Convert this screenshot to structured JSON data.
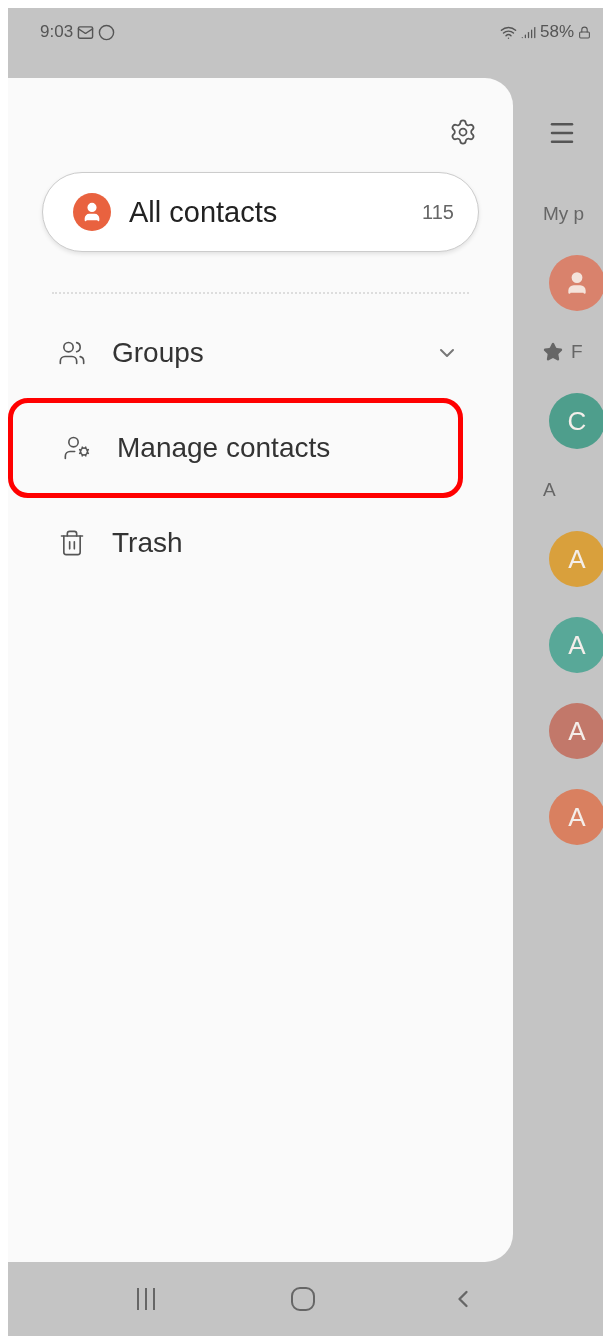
{
  "status_bar": {
    "time": "9:03",
    "battery": "58%"
  },
  "drawer": {
    "all_contacts": {
      "label": "All contacts",
      "count": "115"
    },
    "items": [
      {
        "kind": "groups",
        "label": "Groups",
        "expandable": true,
        "highlighted": false
      },
      {
        "kind": "manage",
        "label": "Manage contacts",
        "expandable": false,
        "highlighted": true
      },
      {
        "kind": "trash",
        "label": "Trash",
        "expandable": false,
        "highlighted": false
      }
    ]
  },
  "background_list": {
    "entries": [
      {
        "kind": "header",
        "label": "My p"
      },
      {
        "kind": "profile",
        "color": "#d9826c"
      },
      {
        "kind": "favorites",
        "label": "F"
      },
      {
        "kind": "contact",
        "initial": "C",
        "color": "#4e9e8c"
      },
      {
        "kind": "header",
        "label": "A"
      },
      {
        "kind": "contact",
        "initial": "A",
        "color": "#d9a03c"
      },
      {
        "kind": "contact",
        "initial": "A",
        "color": "#58a898"
      },
      {
        "kind": "contact",
        "initial": "A",
        "color": "#c2786a"
      },
      {
        "kind": "contact",
        "initial": "A",
        "color": "#d98060"
      }
    ]
  }
}
